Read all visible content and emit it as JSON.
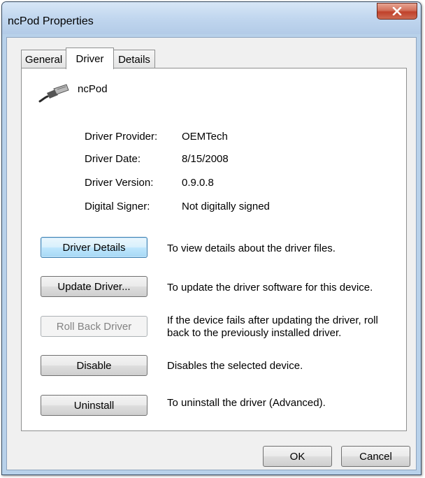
{
  "window": {
    "title": "ncPod Properties"
  },
  "tabs": [
    {
      "label": "General"
    },
    {
      "label": "Driver"
    },
    {
      "label": "Details"
    }
  ],
  "active_tab": "Driver",
  "device": {
    "name": "ncPod",
    "icon": "usb-cable-icon"
  },
  "driver_info": {
    "provider": {
      "label": "Driver Provider:",
      "value": "OEMTech"
    },
    "date": {
      "label": "Driver Date:",
      "value": "8/15/2008"
    },
    "version": {
      "label": "Driver Version:",
      "value": "0.9.0.8"
    },
    "signer": {
      "label": "Digital Signer:",
      "value": "Not digitally signed"
    }
  },
  "actions": [
    {
      "label": "Driver Details",
      "description": "To view details about the driver files.",
      "state": "focused"
    },
    {
      "label": "Update Driver...",
      "description": "To update the driver software for this device.",
      "state": "enabled"
    },
    {
      "label": "Roll Back Driver",
      "description": "If the device fails after updating the driver, roll back to the previously installed driver.",
      "state": "disabled"
    },
    {
      "label": "Disable",
      "description": "Disables the selected device.",
      "state": "enabled"
    },
    {
      "label": "Uninstall",
      "description": "To uninstall the driver (Advanced).",
      "state": "enabled"
    }
  ],
  "footer": {
    "ok_label": "OK",
    "cancel_label": "Cancel"
  },
  "colors": {
    "close_button": "#c7432b",
    "focused_button_border": "#3c7fb1",
    "disabled_text": "#838383"
  }
}
